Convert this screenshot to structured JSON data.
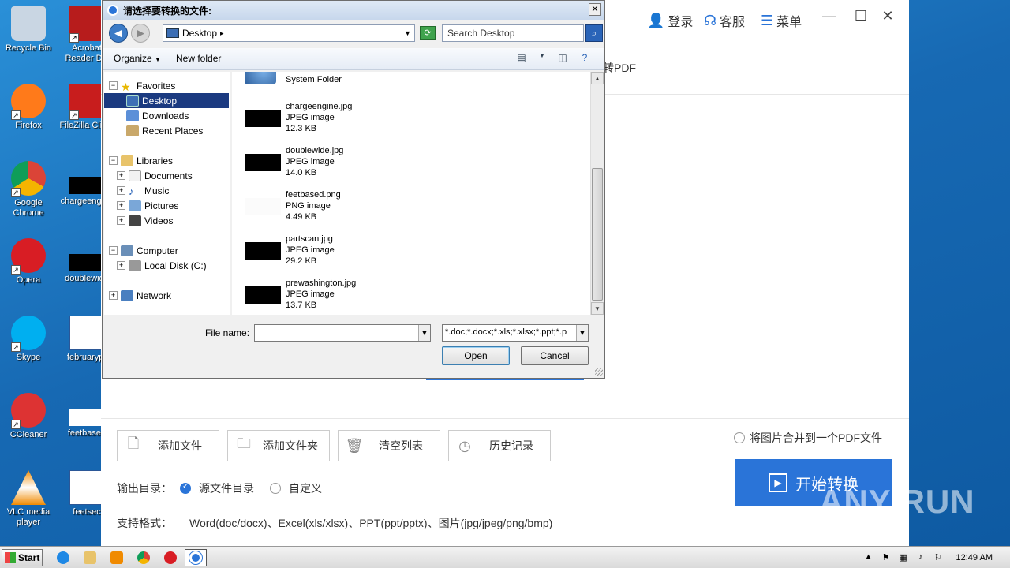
{
  "desktop": {
    "icons": [
      {
        "label": "Recycle Bin",
        "color": "#c9d6e3"
      },
      {
        "label": "Acrobat Reader DC",
        "color": "#b71c1c"
      },
      {
        "label": "Firefox",
        "color": "#ff7a1a"
      },
      {
        "label": "FileZilla Client",
        "color": "#c81d1d"
      },
      {
        "label": "Google Chrome",
        "color": "#4285f4"
      },
      {
        "label": "chargeengine",
        "color": "#000000"
      },
      {
        "label": "Opera",
        "color": "#d81d24"
      },
      {
        "label": "doublewide",
        "color": "#000000"
      },
      {
        "label": "Skype",
        "color": "#00aff0"
      },
      {
        "label": "februarypr",
        "color": "#ffffff"
      },
      {
        "label": "CCleaner",
        "color": "#d33"
      },
      {
        "label": "feetbased",
        "color": "#ffffff"
      },
      {
        "label": "VLC media player",
        "color": "#f08a00"
      },
      {
        "label": "feetsec",
        "color": "#ffffff"
      }
    ]
  },
  "app": {
    "login": "登录",
    "service": "客服",
    "menu": "菜单",
    "convert_label": "转PDF",
    "buttons": {
      "add_file": "添加文件",
      "add_folder": "添加文件夹",
      "clear_list": "清空列表",
      "history": "历史记录"
    },
    "output_label": "输出目录：",
    "output_source": "源文件目录",
    "output_custom": "自定义",
    "formats_label": "支持格式：",
    "formats_value": "Word(doc/docx)、Excel(xls/xlsx)、PPT(ppt/pptx)、图片(jpg/jpeg/png/bmp)",
    "merge_label": "将图片合并到一个PDF文件",
    "start_button": "开始转换",
    "accent": "#2a74d8"
  },
  "dialog": {
    "title": "请选择要转换的文件:",
    "location": "Desktop",
    "search_placeholder": "Search Desktop",
    "organize": "Organize",
    "new_folder": "New folder",
    "nav": {
      "favorites": "Favorites",
      "desktop": "Desktop",
      "downloads": "Downloads",
      "recent": "Recent Places",
      "libraries": "Libraries",
      "documents": "Documents",
      "music": "Music",
      "pictures": "Pictures",
      "videos": "Videos",
      "computer": "Computer",
      "local_disk": "Local Disk (C:)",
      "network": "Network"
    },
    "network_type": "System Folder",
    "files": [
      {
        "name": "chargeengine.jpg",
        "type": "JPEG image",
        "size": "12.3 KB"
      },
      {
        "name": "doublewide.jpg",
        "type": "JPEG image",
        "size": "14.0 KB"
      },
      {
        "name": "feetbased.png",
        "type": "PNG image",
        "size": "4.49 KB"
      },
      {
        "name": "partscan.jpg",
        "type": "JPEG image",
        "size": "29.2 KB"
      },
      {
        "name": "prewashington.jpg",
        "type": "JPEG image",
        "size": "13.7 KB"
      }
    ],
    "file_name_label": "File name:",
    "file_name_value": "",
    "file_type": "*.doc;*.docx;*.xls;*.xlsx;*.ppt;*.p",
    "open": "Open",
    "cancel": "Cancel"
  },
  "watermark": "ANY RUN",
  "taskbar": {
    "start": "Start",
    "time": "12:49 AM"
  }
}
